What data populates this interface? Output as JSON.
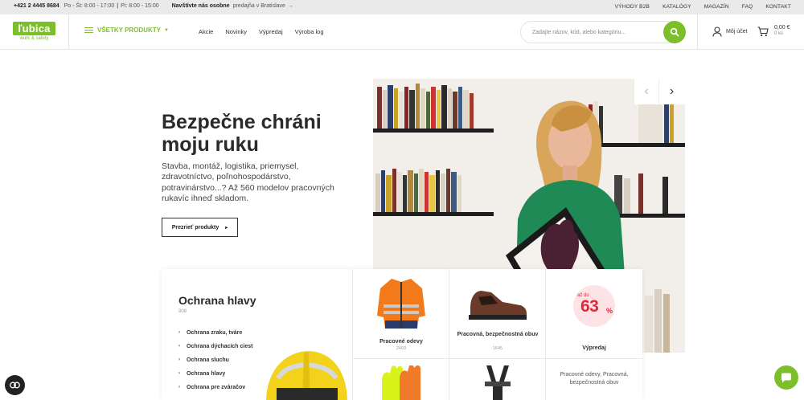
{
  "topbar": {
    "phone": "+421 2 4445 8684",
    "hours_weekday": "Po - Št: 8:00 - 17:00",
    "hours_friday": "Pi: 8:00 - 15:00",
    "visit_title": "Navštívte nás osobne",
    "visit_sub": "predajňa v Bratislave",
    "links": [
      "VÝHODY B2B",
      "KATALÓGY",
      "MAGAZÍN",
      "FAQ",
      "KONTAKT"
    ]
  },
  "header": {
    "logo_text": "ľubica",
    "logo_tagline": "work & safety",
    "all_products": "VŠETKY PRODUKTY",
    "nav": [
      "Akcie",
      "Novinky",
      "Výpredaj",
      "Výroba log"
    ],
    "search_placeholder": "Zadajte názov, kód, alebo kategóriu...",
    "account_label": "Môj účet",
    "cart_price": "0,00 €",
    "cart_qty": "0 ks"
  },
  "hero": {
    "title": "Bezpečne chráni moju ruku",
    "description": "Stavba, montáž, logistika, priemysel, zdravotníctvo, poľnohospodárstvo, potravinárstvo...? Až 560 modelov pracovných rukavíc ihneď skladom.",
    "button_label": "Prezrieť produkty"
  },
  "categories": {
    "title": "Ochrana hlavy",
    "count": "908",
    "items": [
      "Ochrana zraku, tváre",
      "Ochrana dýchacích ciest",
      "Ochrana sluchu",
      "Ochrana hlavy",
      "Ochrana pre zváračov"
    ]
  },
  "tiles": [
    {
      "label": "Pracovné odevy",
      "count": "2493"
    },
    {
      "label": "Pracovná, bezpečnostná obuv",
      "count": "1645"
    },
    {
      "label": "Výpredaj",
      "promo_prefix": "až do",
      "promo_value": "63",
      "promo_unit": "%"
    }
  ],
  "info_text": "Pracovné odevy, Pracovná, bezpečnostná obuv",
  "colors": {
    "accent": "#7cbf2a",
    "promo": "#e0283a"
  }
}
